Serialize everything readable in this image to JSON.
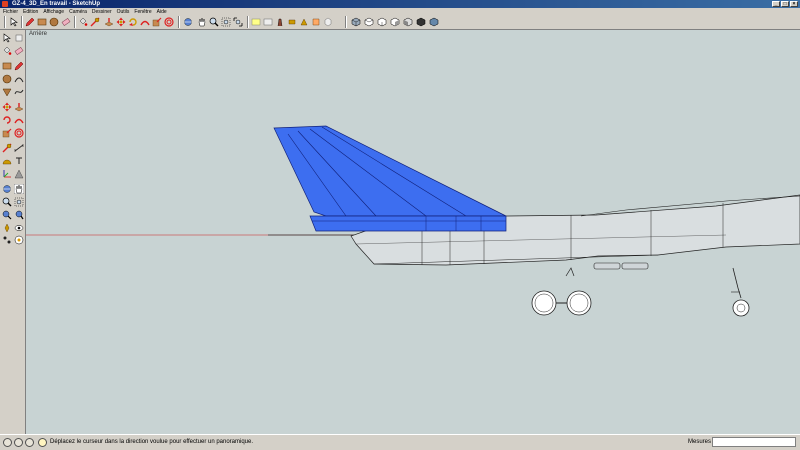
{
  "window": {
    "title": "GZ-4_3D_En travail - SketchUp"
  },
  "menu": [
    "Fichier",
    "Edition",
    "Affichage",
    "Caméra",
    "Dessiner",
    "Outils",
    "Fenêtre",
    "Aide"
  ],
  "viewport": {
    "scene_label": "Arrière"
  },
  "status": {
    "message": "Déplacez le curseur dans la direction voulue pour effectuer un panoramique.",
    "measure_label": "Mesures",
    "measure_value": ""
  },
  "colors": {
    "selection": "#3d6ef0",
    "axis_red": "#cc2222",
    "background": "#c8d3d3"
  },
  "toolbar_icons": [
    "select-icon",
    "pencil-icon",
    "rectangle-icon",
    "circle-icon",
    "eraser-icon",
    "paint-bucket-icon",
    "tape-measure-icon",
    "push-pull-icon",
    "move-icon",
    "rotate-icon",
    "follow-me-icon",
    "scale-icon",
    "orbit-icon",
    "pan-icon",
    "zoom-icon",
    "zoom-extents-icon",
    "text-icon",
    "dimension-icon",
    "walk-icon",
    "look-around-icon",
    "section-icon",
    "components-icon",
    "iso-view-icon",
    "top-view-icon",
    "front-view-icon",
    "right-view-icon",
    "back-view-icon",
    "left-view-icon"
  ]
}
